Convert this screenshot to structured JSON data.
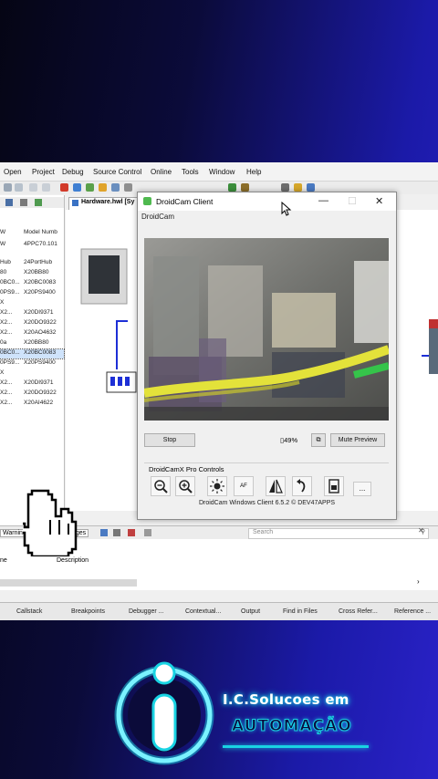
{
  "menu": [
    "Open",
    "Project",
    "Debug",
    "Source Control",
    "Online",
    "Tools",
    "Window",
    "Help"
  ],
  "hardware_tab": "Hardware.hwl [Sy",
  "left_pane": {
    "header": {
      "col1": "W",
      "col2": "Model Numb"
    },
    "rows": [
      {
        "a": "W",
        "b": "4PPC70.101"
      },
      {
        "a": "Hub",
        "b": "24PortHub"
      },
      {
        "a": "80",
        "b": "X20BB80"
      },
      {
        "a": "0BC0...",
        "b": "X20BC0083"
      },
      {
        "a": "0PS9...",
        "b": "X20PS9400"
      },
      {
        "a": "X",
        "b": ""
      },
      {
        "a": "X2...",
        "b": "X20DI9371"
      },
      {
        "a": "X2...",
        "b": "X20DO9322"
      },
      {
        "a": "X2...",
        "b": "X20AO4632"
      },
      {
        "a": "0a",
        "b": "X20BB80"
      },
      {
        "a": "0BC0...",
        "b": "X20BC0083"
      },
      {
        "a": "0PS9...",
        "b": "X20PS9400"
      },
      {
        "a": "X",
        "b": ""
      },
      {
        "a": "X2...",
        "b": "X20DI9371"
      },
      {
        "a": "X2...",
        "b": "X20DO9322"
      },
      {
        "a": "X2...",
        "b": "X20AI4622"
      }
    ]
  },
  "droidcam": {
    "title": "DroidCam Client",
    "subtitle": "DroidCam",
    "stop": "Stop",
    "battery": "49%",
    "mute": "Mute Preview",
    "pro_controls": "DroidCamX Pro Controls",
    "af": "AF",
    "more": "...",
    "footer": "DroidCam Windows Client 6.5.2 © DEV47APPS"
  },
  "bottom": {
    "tab_warnings": "Warnings",
    "tab_messages": "ages",
    "search": "Search",
    "col_name": "ne",
    "col_description": "Description"
  },
  "statusbar": [
    "Callstack",
    "Breakpoints",
    "Debugger ...",
    "Contextual...",
    "Output",
    "Find in Files",
    "Cross Refer...",
    "Reference ..."
  ],
  "logo": {
    "line1": "I.C.Solucoes em",
    "line2": "AUTOMAÇÃO"
  },
  "colors": {
    "accent_cyan": "#19d3e3",
    "brand_blue": "#1e1ab8"
  }
}
